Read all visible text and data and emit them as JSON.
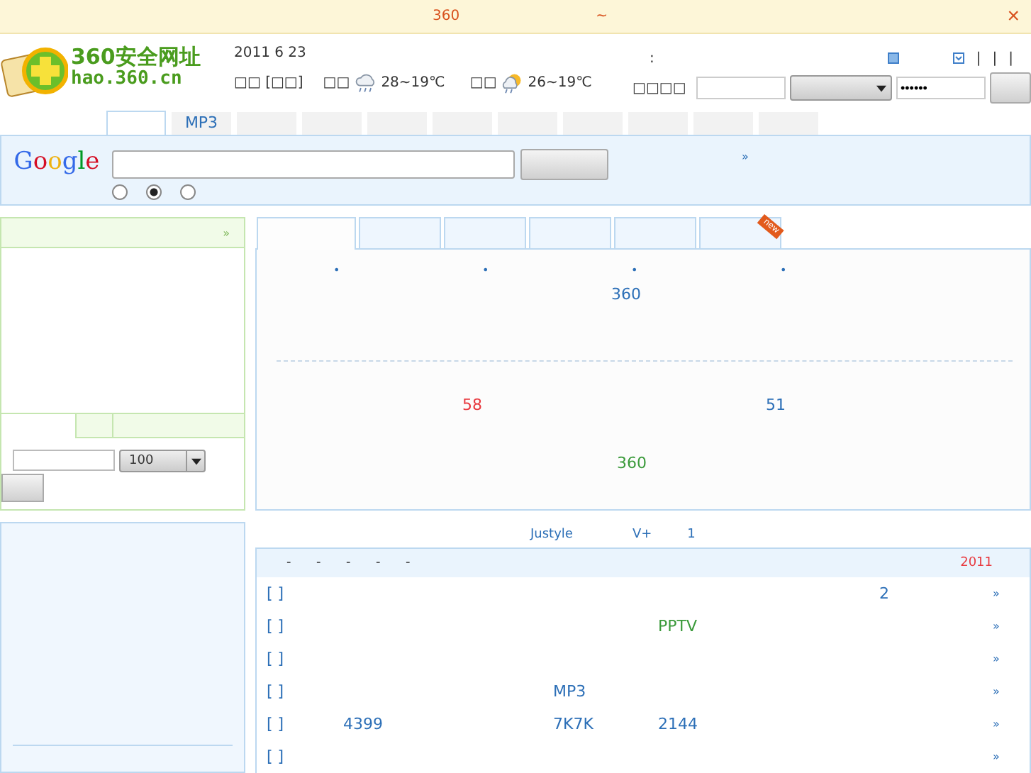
{
  "notice": {
    "texts": [
      "360",
      "~"
    ],
    "close": "×"
  },
  "logo": {
    "title": "360安全网址",
    "url": "hao.360.cn"
  },
  "header": {
    "date": "2011 6 23",
    "location": "□□ [□□]",
    "weather": [
      {
        "city": "□□",
        "temp": "28~19℃",
        "kind": "rain"
      },
      {
        "city": "□□",
        "temp": "26~19℃",
        "kind": "sun-rain"
      }
    ],
    "colon": ":",
    "separators": [
      "|",
      "|",
      "|"
    ],
    "login_label": "□□□□",
    "password": "••••••"
  },
  "nav_tabs": [
    {
      "selected": true
    },
    {
      "label": "MP3",
      "selected": false
    },
    {
      "selected": false
    },
    {
      "selected": false
    },
    {
      "selected": false
    },
    {
      "selected": false
    },
    {
      "selected": false
    },
    {
      "selected": false
    },
    {
      "selected": false
    },
    {
      "selected": false
    },
    {
      "selected": false
    }
  ],
  "search": {
    "logo": "Google",
    "radios": [
      {
        "selected": false
      },
      {
        "selected": true
      },
      {
        "selected": false
      }
    ],
    "more": "»"
  },
  "left_panel": {
    "more": "»",
    "subtabs": [
      {
        "selected": true
      },
      {
        "selected": false
      },
      {
        "selected": false
      }
    ],
    "select_value": "100"
  },
  "center": {
    "tabs": [
      {
        "selected": true
      },
      {
        "selected": false
      },
      {
        "selected": false
      },
      {
        "selected": false
      },
      {
        "selected": false
      },
      {
        "selected": false,
        "badge": "new"
      }
    ],
    "bullets": [
      "•",
      "•",
      "•",
      "•"
    ],
    "top_link": "360",
    "links": [
      {
        "text": "58",
        "color": "#e8393f"
      },
      {
        "text": "51",
        "color": "#2c6fb7"
      }
    ],
    "bottom_link": "360"
  },
  "ticker": [
    "Justyle",
    "V+",
    "1"
  ],
  "news": {
    "separators": [
      "-",
      "-",
      "-",
      "-",
      "-"
    ],
    "date": "2011",
    "rows": [
      {
        "bracket": "[ ]",
        "cells": [
          {
            "text": ""
          },
          {
            "text": ""
          },
          {
            "text": ""
          },
          {
            "text": "2",
            "color": "#2c6fb7"
          }
        ],
        "more": "»"
      },
      {
        "bracket": "[ ]",
        "cells": [
          {
            "text": ""
          },
          {
            "text": ""
          },
          {
            "text": "PPTV",
            "color": "#3a9a3a"
          },
          {
            "text": ""
          }
        ],
        "more": "»"
      },
      {
        "bracket": "[ ]",
        "cells": [
          {
            "text": ""
          },
          {
            "text": ""
          },
          {
            "text": ""
          },
          {
            "text": ""
          }
        ],
        "more": "»"
      },
      {
        "bracket": "[ ]",
        "cells": [
          {
            "text": ""
          },
          {
            "text": "MP3",
            "color": "#2c6fb7"
          },
          {
            "text": ""
          },
          {
            "text": ""
          }
        ],
        "more": "»"
      },
      {
        "bracket": "[ ]",
        "cells": [
          {
            "text": "4399",
            "color": "#2c6fb7"
          },
          {
            "text": "7K7K",
            "color": "#2c6fb7"
          },
          {
            "text": "2144",
            "color": "#2c6fb7"
          },
          {
            "text": ""
          }
        ],
        "more": "»"
      },
      {
        "bracket": "[ ]",
        "cells": [
          {
            "text": ""
          },
          {
            "text": ""
          },
          {
            "text": ""
          },
          {
            "text": ""
          }
        ],
        "more": "»"
      }
    ]
  }
}
